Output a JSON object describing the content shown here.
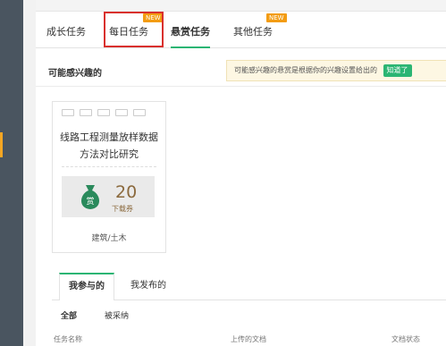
{
  "tabs": {
    "growth": "成长任务",
    "daily": "每日任务",
    "bounty": "悬赏任务",
    "other": "其他任务",
    "new_badge": "NEW"
  },
  "interest": {
    "title": "可能感兴趣的",
    "hint": "可能感兴趣的悬赏是根据你的兴趣设置给出的",
    "got_it": "知道了"
  },
  "card": {
    "title": "线路工程测量放样数据方法对比研究",
    "reward_icon_text": "赏",
    "reward_value": "20",
    "reward_unit": "下载券",
    "category": "建筑/土木"
  },
  "bottom_tabs": {
    "joined": "我参与的",
    "published": "我发布的"
  },
  "filters": {
    "all": "全部",
    "adopted": "被采纳"
  },
  "table_headers": {
    "task_name": "任务名称",
    "uploaded_doc": "上传的文档",
    "doc_status": "文档状态"
  },
  "colors": {
    "accent_green": "#2bb573",
    "highlight_red": "#d9302d",
    "badge_orange": "#f39c12",
    "sidebar": "#4a5560"
  }
}
